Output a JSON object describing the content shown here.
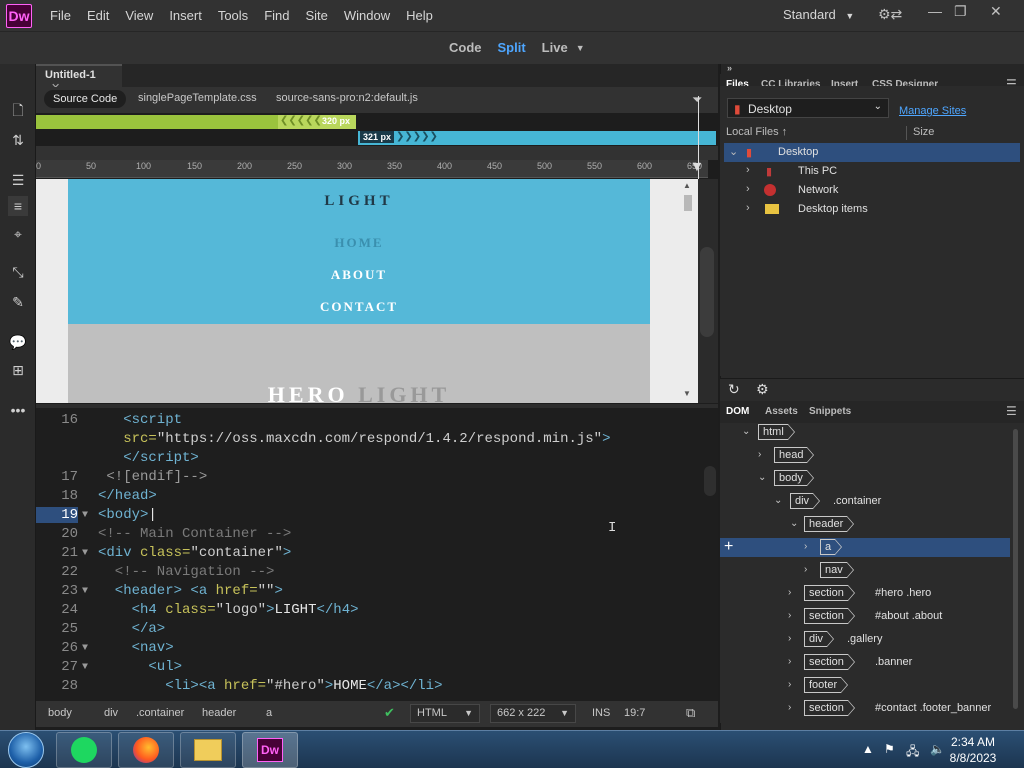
{
  "app": {
    "logo": "Dw",
    "name": "Adobe Dreamweaver"
  },
  "menu": [
    "File",
    "Edit",
    "View",
    "Insert",
    "Tools",
    "Find",
    "Site",
    "Window",
    "Help"
  ],
  "workspace": "Standard",
  "view_modes": {
    "code": "Code",
    "split": "Split",
    "live": "Live",
    "active": "Split"
  },
  "document": {
    "tab_title": "Untitled-1",
    "source_pill": "Source Code",
    "related_files": [
      "singlePageTemplate.css",
      "source-sans-pro:n2:default.js"
    ]
  },
  "media_queries": {
    "bar1_label": "320  px",
    "bar2_label": "321  px"
  },
  "ruler_ticks": [
    "0",
    "50",
    "100",
    "150",
    "200",
    "250",
    "300",
    "350",
    "400",
    "450",
    "500",
    "550",
    "600",
    "650"
  ],
  "design_view": {
    "logo": "LIGHT",
    "nav": [
      "HOME",
      "ABOUT",
      "CONTACT"
    ],
    "hero_words": [
      "HERO",
      "LIGHT"
    ]
  },
  "code_lines": [
    {
      "n": "16",
      "fold": "",
      "html": "<span class=\"tag\">   &lt;script</span>"
    },
    {
      "n": "",
      "fold": "",
      "html": "<span class=\"attr\">   src=</span><span class=\"str\">\"https://oss.maxcdn.com/respond/1.4.2/respond.min.js\"</span><span class=\"tag\">&gt;</span>"
    },
    {
      "n": "",
      "fold": "",
      "html": "<span class=\"tag\">   &lt;/script&gt;</span>"
    },
    {
      "n": "17",
      "fold": "",
      "html": "<span class=\"grey\"> &lt;![endif]--&gt;</span>"
    },
    {
      "n": "18",
      "fold": "",
      "html": "<span class=\"tag\">&lt;/head&gt;</span>"
    },
    {
      "n": "19",
      "fold": "▼",
      "active": true,
      "html": "<span class=\"tag\">&lt;body&gt;</span><span class=\"txt\">|</span>"
    },
    {
      "n": "20",
      "fold": "",
      "html": "<span class=\"cmt\">&lt;!-- Main Container --&gt;</span>"
    },
    {
      "n": "21",
      "fold": "▼",
      "html": "<span class=\"tag\">&lt;div </span><span class=\"attr\">class=</span><span class=\"str\">\"container\"</span><span class=\"tag\">&gt;</span>"
    },
    {
      "n": "22",
      "fold": "",
      "html": "<span class=\"cmt\">  &lt;!-- Navigation --&gt;</span>"
    },
    {
      "n": "23",
      "fold": "▼",
      "html": "<span class=\"tag\">  &lt;header&gt; &lt;a </span><span class=\"attr\">href=</span><span class=\"str\">\"\"</span><span class=\"tag\">&gt;</span>"
    },
    {
      "n": "24",
      "fold": "",
      "html": "<span class=\"tag\">    &lt;h4 </span><span class=\"attr\">class=</span><span class=\"str\">\"logo\"</span><span class=\"tag\">&gt;</span><span class=\"txt\">LIGHT</span><span class=\"tag\">&lt;/h4&gt;</span>"
    },
    {
      "n": "25",
      "fold": "",
      "html": "<span class=\"tag\">    &lt;/a&gt;</span>"
    },
    {
      "n": "26",
      "fold": "▼",
      "html": "<span class=\"tag\">    &lt;nav&gt;</span>"
    },
    {
      "n": "27",
      "fold": "▼",
      "html": "<span class=\"tag\">      &lt;ul&gt;</span>"
    },
    {
      "n": "28",
      "fold": "",
      "html": "<span class=\"tag\">        &lt;li&gt;&lt;a </span><span class=\"attr\">href=</span><span class=\"str\">\"#hero\"</span><span class=\"tag\">&gt;</span><span class=\"txt\">HOME</span><span class=\"tag\">&lt;/a&gt;&lt;/li&gt;</span>"
    }
  ],
  "status_bar": {
    "breadcrumbs": [
      "body",
      "div",
      ".container",
      "header",
      "a"
    ],
    "doc_type": "HTML",
    "dimensions": "662 x 222",
    "mode": "INS",
    "cursor": "19:7"
  },
  "files_panel": {
    "tabs": [
      "Files",
      "CC Libraries",
      "Insert",
      "CSS Designer"
    ],
    "site": "Desktop",
    "manage_sites": "Manage Sites",
    "local_files_header": "Local Files",
    "size_header": "Size",
    "tree": [
      "Desktop",
      "This PC",
      "Network",
      "Desktop items"
    ]
  },
  "dom_panel": {
    "tabs": [
      "DOM",
      "Assets",
      "Snippets"
    ],
    "nodes": [
      {
        "tag": "html",
        "sel": ""
      },
      {
        "tag": "head",
        "sel": ""
      },
      {
        "tag": "body",
        "sel": ""
      },
      {
        "tag": "div",
        "sel": ".container"
      },
      {
        "tag": "header",
        "sel": ""
      },
      {
        "tag": "a",
        "sel": ""
      },
      {
        "tag": "nav",
        "sel": ""
      },
      {
        "tag": "section",
        "sel": "#hero .hero"
      },
      {
        "tag": "section",
        "sel": "#about .about"
      },
      {
        "tag": "div",
        "sel": ".gallery"
      },
      {
        "tag": "section",
        "sel": ".banner"
      },
      {
        "tag": "footer",
        "sel": ""
      },
      {
        "tag": "section",
        "sel": "#contact .footer_banner"
      }
    ]
  },
  "taskbar": {
    "time": "2:34 AM",
    "date": "8/8/2023"
  },
  "colors": {
    "accent": "#4ea6ff",
    "brand": "#ff61f6",
    "selection": "#2e4f7e",
    "header_bg": "#55b8d8"
  }
}
